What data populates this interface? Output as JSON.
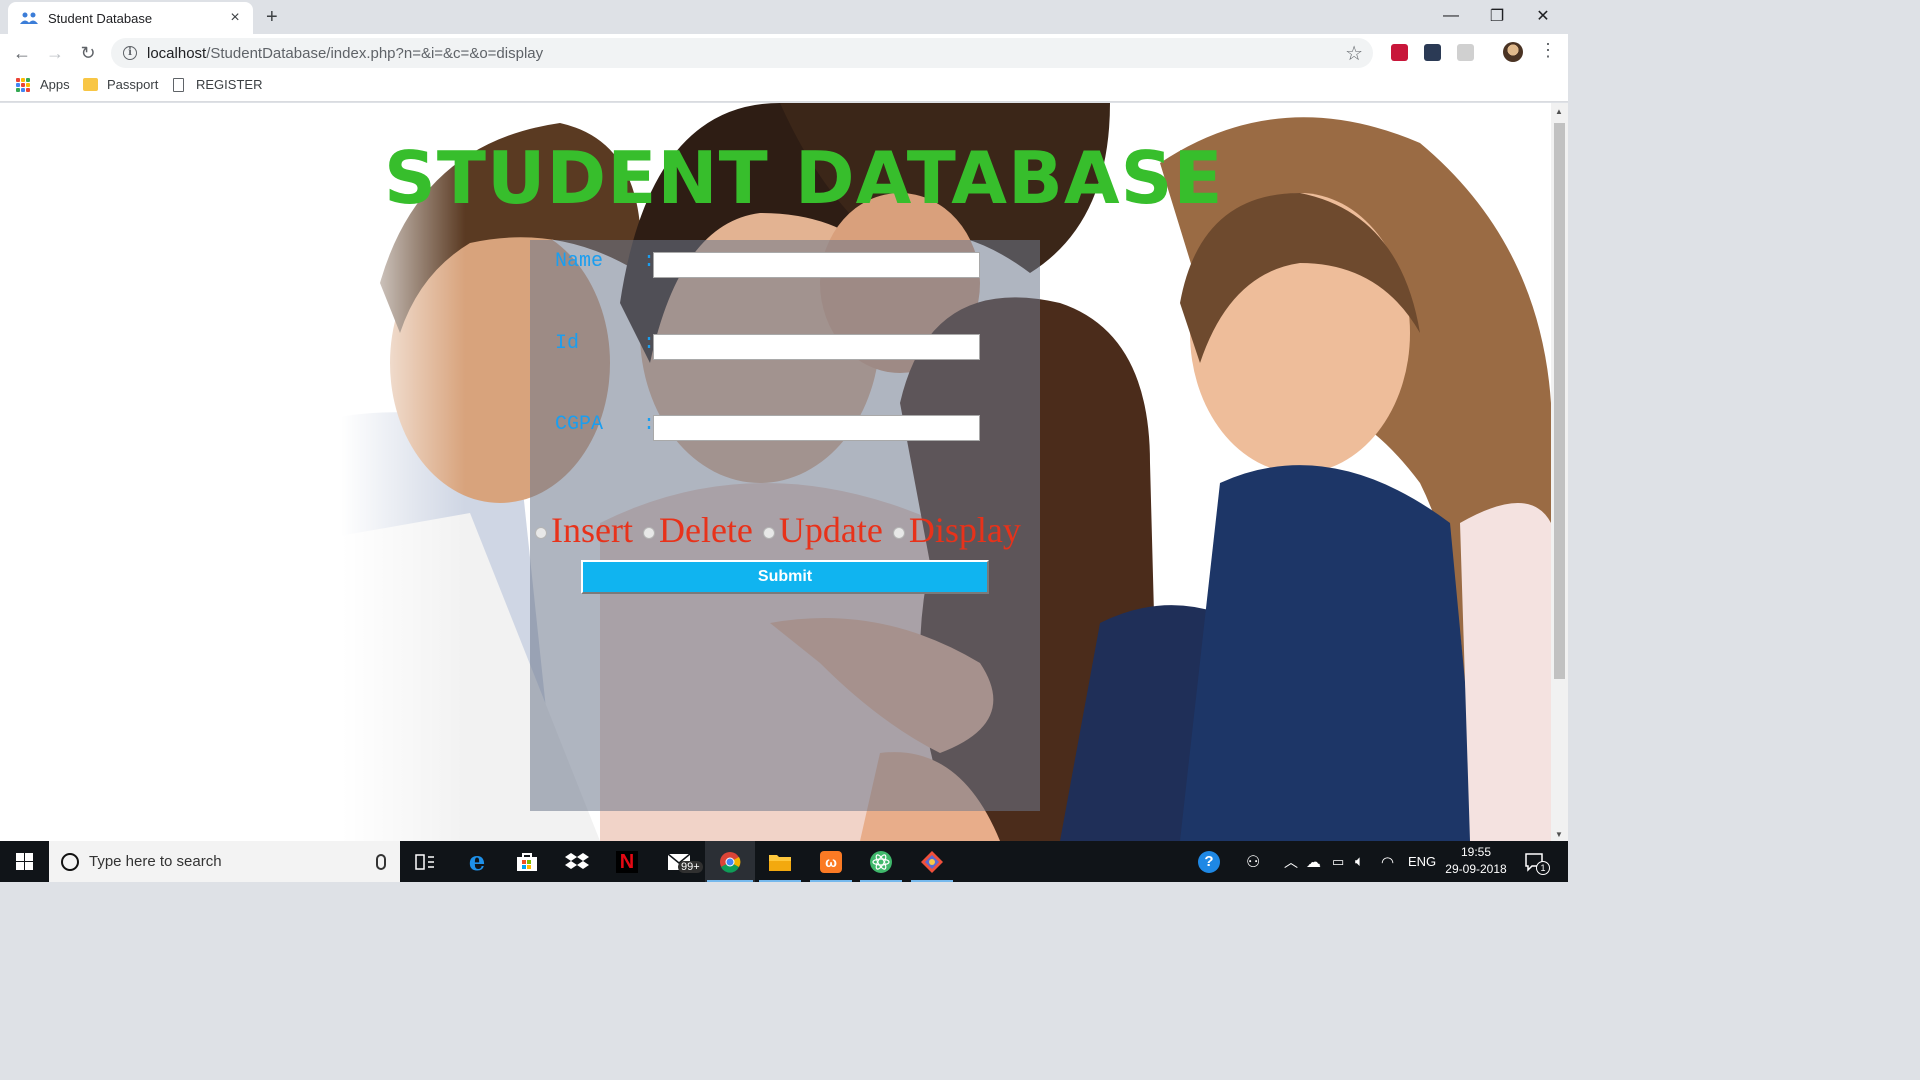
{
  "browser": {
    "tab_title": "Student Database",
    "tab_close": "×",
    "new_tab": "+",
    "url_host": "localhost",
    "url_path": "/StudentDatabase/index.php?n=&i=&c=&o=display",
    "window_min": "—",
    "window_max": "❐",
    "window_close": "✕",
    "back": "←",
    "forward": "→",
    "reload": "↻",
    "star": "☆",
    "menu": "⋮"
  },
  "bookmarks": {
    "apps": "Apps",
    "passport": "Passport",
    "register": "REGISTER"
  },
  "page": {
    "title": "STUDENT DATABASE",
    "fields": {
      "name_label": "Name",
      "id_label": "Id",
      "cgpa_label": "CGPA",
      "colon": ":",
      "name_value": "",
      "id_value": "",
      "cgpa_value": ""
    },
    "options": {
      "insert": "Insert",
      "delete": "Delete",
      "update": "Update",
      "display": "Display"
    },
    "submit": "Submit"
  },
  "taskbar": {
    "search_placeholder": "Type here to search",
    "mail_badge": "99+",
    "lang": "ENG",
    "time": "19:55",
    "date": "29-09-2018",
    "notif_count": "1"
  },
  "colors": {
    "title_green": "#37be2c",
    "label_blue": "#1a9ef0",
    "option_red": "#e8321a",
    "submit_blue": "#10b4f0"
  }
}
